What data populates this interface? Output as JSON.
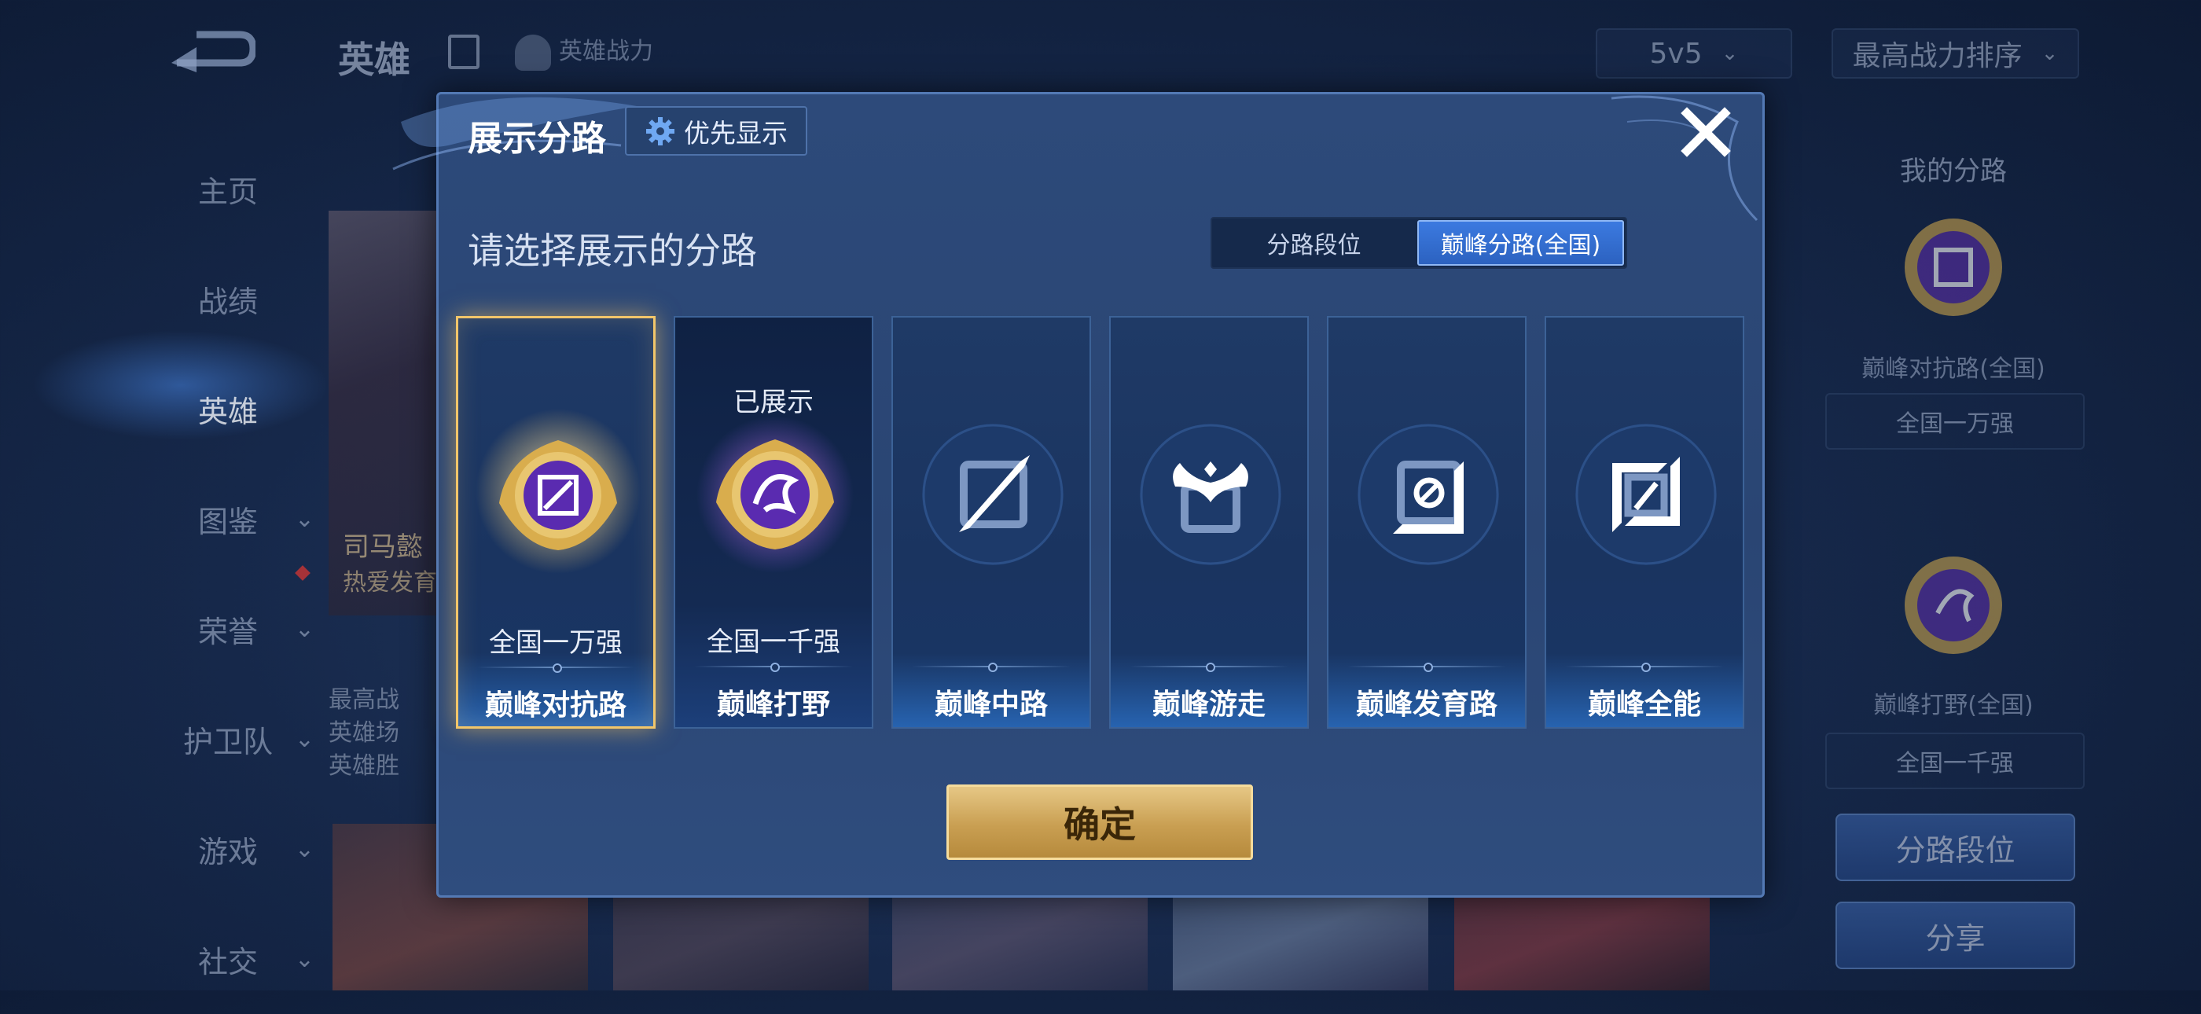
{
  "background": {
    "top_title": "英雄",
    "top_power_label": "英雄战力",
    "mode_select": "5v5",
    "sort_select": "最高战力排序",
    "sidebar": [
      {
        "label": "主页",
        "has_chevron": false
      },
      {
        "label": "战绩",
        "has_chevron": false
      },
      {
        "label": "英雄",
        "has_chevron": false,
        "active": true
      },
      {
        "label": "图鉴",
        "has_chevron": true
      },
      {
        "label": "荣誉",
        "has_chevron": true
      },
      {
        "label": "护卫队",
        "has_chevron": true
      },
      {
        "label": "游戏",
        "has_chevron": true
      },
      {
        "label": "社交",
        "has_chevron": true
      }
    ],
    "hero_card": {
      "name": "司马懿",
      "sub": "热爱发育",
      "stats": [
        "最高战",
        "英雄场",
        "英雄胜"
      ]
    },
    "right_panel": {
      "title": "我的分路",
      "lane1_label": "巅峰对抗路(全国)",
      "lane1_rank": "全国一万强",
      "lane2_label": "巅峰打野(全国)",
      "lane2_rank": "全国一千强",
      "btn_lane_rank": "分路段位",
      "btn_share": "分享"
    }
  },
  "modal": {
    "title": "展示分路",
    "priority_button": "优先显示",
    "subtitle": "请选择展示的分路",
    "segment": {
      "options": [
        "分路段位",
        "巅峰分路(全国)"
      ],
      "selected_index": 1
    },
    "lanes": [
      {
        "name": "巅峰对抗路",
        "rank": "全国一万强",
        "selected": true,
        "shown": false
      },
      {
        "name": "巅峰打野",
        "rank": "全国一千强",
        "selected": false,
        "shown": true,
        "shown_label": "已展示"
      },
      {
        "name": "巅峰中路",
        "rank": "",
        "selected": false,
        "shown": false
      },
      {
        "name": "巅峰游走",
        "rank": "",
        "selected": false,
        "shown": false
      },
      {
        "name": "巅峰发育路",
        "rank": "",
        "selected": false,
        "shown": false
      },
      {
        "name": "巅峰全能",
        "rank": "",
        "selected": false,
        "shown": false
      }
    ],
    "confirm_button": "确定"
  },
  "colors": {
    "accent_gold": "#f2c66a",
    "segment_active": "#3c7ae0",
    "modal_bg": "#2d4a7a"
  },
  "icons": [
    "back-arrow-icon",
    "list-icon",
    "power-figure-icon",
    "chevron-down-icon",
    "gear-icon",
    "close-icon",
    "top-lane-emblem-icon",
    "jungle-dragon-emblem-icon",
    "mid-lane-icon",
    "roam-wings-icon",
    "farm-lane-icon",
    "all-round-icon"
  ]
}
